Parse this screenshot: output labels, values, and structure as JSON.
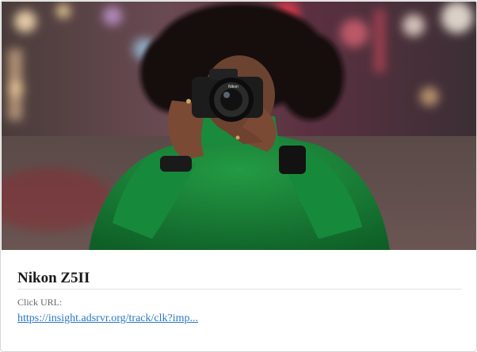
{
  "card": {
    "image": {
      "description_icon": "photo-woman-with-camera",
      "colors": {
        "sweater": "#1a7a34",
        "hair": "#120e0c",
        "camera": "#1c1c1c",
        "background": "#3a2a2c"
      }
    },
    "title": "Nikon Z5II",
    "click_url_label": "Click URL:",
    "click_url": "https://insight.adsrvr.org/track/clk?imp..."
  }
}
